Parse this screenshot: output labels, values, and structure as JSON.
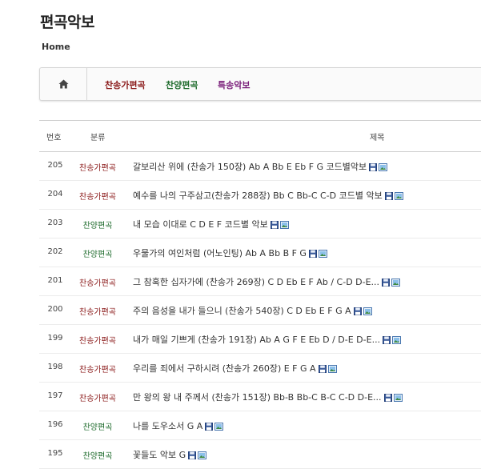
{
  "page": {
    "title": "편곡악보",
    "breadcrumb": "Home"
  },
  "colors": {
    "hymn": "#8b1a1a",
    "praise": "#1e6b2c",
    "special": "#7a1f7a"
  },
  "categories": [
    {
      "label": "찬송가편곡",
      "color": "#8b1a1a"
    },
    {
      "label": "찬양편곡",
      "color": "#1e6b2c"
    },
    {
      "label": "특송악보",
      "color": "#7a1f7a"
    }
  ],
  "table": {
    "headers": {
      "no": "번호",
      "category": "분류",
      "title": "제목"
    },
    "rows": [
      {
        "no": "205",
        "category": "찬송가편곡",
        "cat_color": "#8b1a1a",
        "title": "갈보리산 위에 (찬송가 150장) Ab A Bb E Eb F G 코드별악보"
      },
      {
        "no": "204",
        "category": "찬송가편곡",
        "cat_color": "#8b1a1a",
        "title": "예수를 나의 구주삼고(찬송가 288장) Bb C Bb-C C-D 코드별 악보"
      },
      {
        "no": "203",
        "category": "찬양편곡",
        "cat_color": "#1e6b2c",
        "title": "내 모습 이대로 C D E F 코드별 악보"
      },
      {
        "no": "202",
        "category": "찬양편곡",
        "cat_color": "#1e6b2c",
        "title": "우물가의 여인처럼 (어노인팅) Ab A Bb B F G"
      },
      {
        "no": "201",
        "category": "찬송가편곡",
        "cat_color": "#8b1a1a",
        "title": "그 참혹한 십자가에 (찬송가 269장) C D Eb E F Ab / C-D D-E..."
      },
      {
        "no": "200",
        "category": "찬송가편곡",
        "cat_color": "#8b1a1a",
        "title": "주의 음성을 내가 들으니 (찬송가 540장) C D Eb E F G A"
      },
      {
        "no": "199",
        "category": "찬송가편곡",
        "cat_color": "#8b1a1a",
        "title": "내가 매일 기쁘게 (찬송가 191장) Ab A G F E Eb D / D-E D-E..."
      },
      {
        "no": "198",
        "category": "찬송가편곡",
        "cat_color": "#8b1a1a",
        "title": "우리를 죄에서 구하시려 (찬송가 260장) E F G A"
      },
      {
        "no": "197",
        "category": "찬송가편곡",
        "cat_color": "#8b1a1a",
        "title": "만 왕의 왕 내 주께서 (찬송가 151장) Bb-B Bb-C B-C C-D D-E..."
      },
      {
        "no": "196",
        "category": "찬양편곡",
        "cat_color": "#1e6b2c",
        "title": "나를 도우소서 G A"
      },
      {
        "no": "195",
        "category": "찬양편곡",
        "cat_color": "#1e6b2c",
        "title": "꽃들도 악보 G"
      }
    ]
  },
  "icons": {
    "home": "home-icon",
    "save": "floppy-disk-icon",
    "image": "image-file-icon"
  }
}
